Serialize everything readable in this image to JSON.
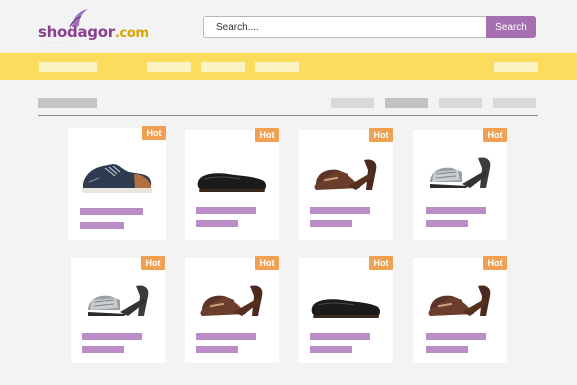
{
  "header": {
    "logo_text_main": "shodagor",
    "logo_text_tld": ".com",
    "logo_tagline": "· ···· ·· ····· ········ · ·· ·· ··",
    "search_placeholder": "Search....",
    "search_button_label": "Search"
  },
  "colors": {
    "accent_purple": "#a56fb0",
    "nav_yellow": "#fcdc5c",
    "hot_badge": "#f0a050",
    "title_placeholder": "#b98cc5"
  },
  "products": [
    {
      "badge": "Hot",
      "image": "sneaker-icon"
    },
    {
      "badge": "Hot",
      "image": "loafer-icon"
    },
    {
      "badge": "Hot",
      "image": "heel-mule-brown-icon"
    },
    {
      "badge": "Hot",
      "image": "heel-mule-silver-icon"
    },
    {
      "badge": "Hot",
      "image": "heel-mule-silver-icon"
    },
    {
      "badge": "Hot",
      "image": "heel-mule-brown-icon"
    },
    {
      "badge": "Hot",
      "image": "loafer-icon"
    },
    {
      "badge": "Hot",
      "image": "heel-mule-brown-icon"
    }
  ]
}
